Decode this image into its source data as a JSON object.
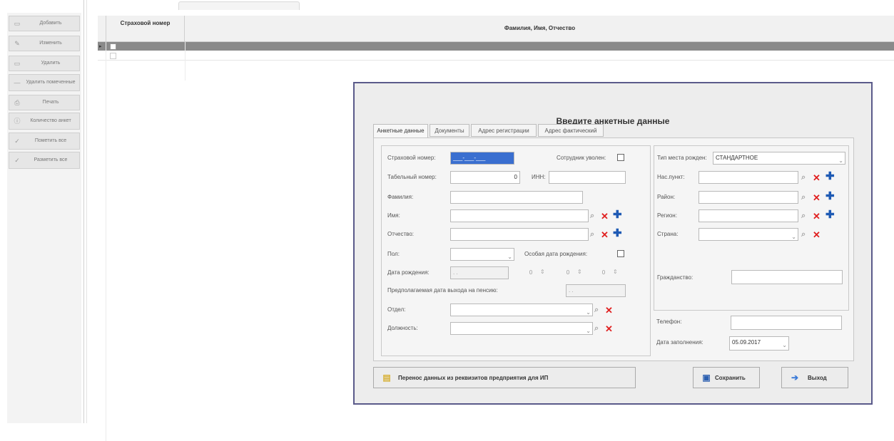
{
  "sidebar": {
    "buttons": [
      {
        "label": "Добавить",
        "icon": "add-icon"
      },
      {
        "label": "Изменить",
        "icon": "edit-icon"
      },
      {
        "label": "Удалить",
        "icon": "delete-icon"
      },
      {
        "label": "Удалить помеченные",
        "icon": "delete-marked-icon"
      },
      {
        "label": "Печать",
        "icon": "print-icon"
      },
      {
        "label": "Количество анкет",
        "icon": "info-icon"
      },
      {
        "label": "Пометить все",
        "icon": "check-all-icon"
      },
      {
        "label": "Разметить все",
        "icon": "uncheck-all-icon"
      }
    ]
  },
  "grid": {
    "columns": [
      "Страховой номер",
      "Фамилия, Имя, Отчество"
    ],
    "selected_marker": "▸"
  },
  "dialog": {
    "title": "Введите анкетные данные",
    "tabs": [
      "Анкетные данные",
      "Документы",
      "Адрес регистрации",
      "Адрес фактический"
    ],
    "left": {
      "insurance_label": "Страховой номер:",
      "insurance_value": "___-___-___",
      "fired_label": "Сотрудник уволен:",
      "tabnum_label": "Табельный номер:",
      "tabnum_value": "0",
      "inn_label": "ИНН:",
      "inn_value": "",
      "lastname_label": "Фамилия:",
      "firstname_label": "Имя:",
      "patronymic_label": "Отчество:",
      "sex_label": "Пол:",
      "special_birth_label": "Особая дата рождения:",
      "birthdate_label": "Дата рождения:",
      "birthdate_value": ". .",
      "spin1": "0",
      "spin2": "0",
      "spin3": "0",
      "pension_label": "Предполагаемая дата выхода на пенсию:",
      "pension_value": ". .",
      "dept_label": "Отдел:",
      "position_label": "Должность:"
    },
    "right": {
      "birthplace_type_label": "Тип места рожден:",
      "birthplace_type_value": "СТАНДАРТНОЕ",
      "locality_label": "Нас.пункт:",
      "district_label": "Район:",
      "region_label": "Регион:",
      "country_label": "Страна:",
      "citizenship_label": "Гражданство:",
      "phone_label": "Телефон:",
      "fill_date_label": "Дата заполнения:",
      "fill_date_value": "05.09.2017"
    },
    "buttons": {
      "transfer": "Перенос данных из реквизитов предприятия для ИП",
      "save": "Сохранить",
      "exit": "Выход"
    }
  },
  "colors": {
    "selected_row": "#8a8a8a",
    "dialog_border": "#5a5a8a",
    "delete_x": "#e02020",
    "add_plus": "#1e5ab4",
    "selection": "#3a6fd0"
  }
}
